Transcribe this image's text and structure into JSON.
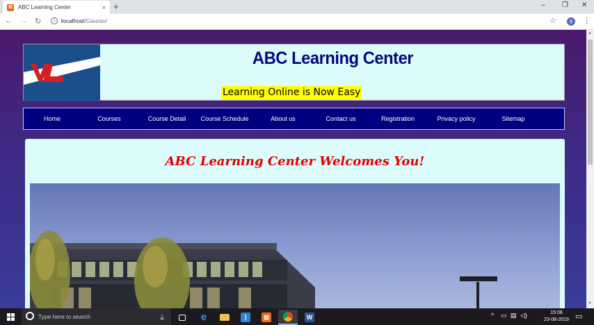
{
  "browser": {
    "tab_title": "ABC Learning Center",
    "close_glyph": "×",
    "new_tab_glyph": "+",
    "url_host": "localhost",
    "url_path": "/Gaurav/",
    "profile_initial": "g",
    "window_controls": {
      "minimize": "–",
      "maximize": "❐",
      "close": "✕"
    },
    "icons": [
      "back-arrow-icon",
      "forward-arrow-icon",
      "reload-icon",
      "info-icon",
      "star-icon",
      "kebab-menu-icon"
    ]
  },
  "site": {
    "title": "ABC Learning Center",
    "tagline": "Learning Online is Now Easy",
    "logo_text": "ABC",
    "nav": [
      {
        "label": "Home"
      },
      {
        "label": "Courses"
      },
      {
        "label": "Course Detail"
      },
      {
        "label": "Course Schedule"
      },
      {
        "label": "About us"
      },
      {
        "label": "Contact us"
      },
      {
        "label": "Registration"
      },
      {
        "label": "Privacy policy"
      },
      {
        "label": "Sitemap"
      }
    ],
    "welcome": "ABC Learning Center Welcomes You!",
    "colors": {
      "title": "#06067e",
      "tagline_bg": "#ffff00",
      "nav_bg": "#000080",
      "welcome": "#e00000",
      "panel_bg": "#dcfcfc"
    }
  },
  "taskbar": {
    "search_placeholder": "Type here to search",
    "apps": [
      {
        "icon": "task-view-icon"
      },
      {
        "icon": "edge-icon"
      },
      {
        "icon": "file-explorer-icon"
      },
      {
        "icon": "vscode-icon"
      },
      {
        "icon": "xampp-icon"
      },
      {
        "icon": "chrome-icon"
      },
      {
        "icon": "word-icon"
      }
    ],
    "time": "15:08",
    "date": "23-08-2019"
  }
}
